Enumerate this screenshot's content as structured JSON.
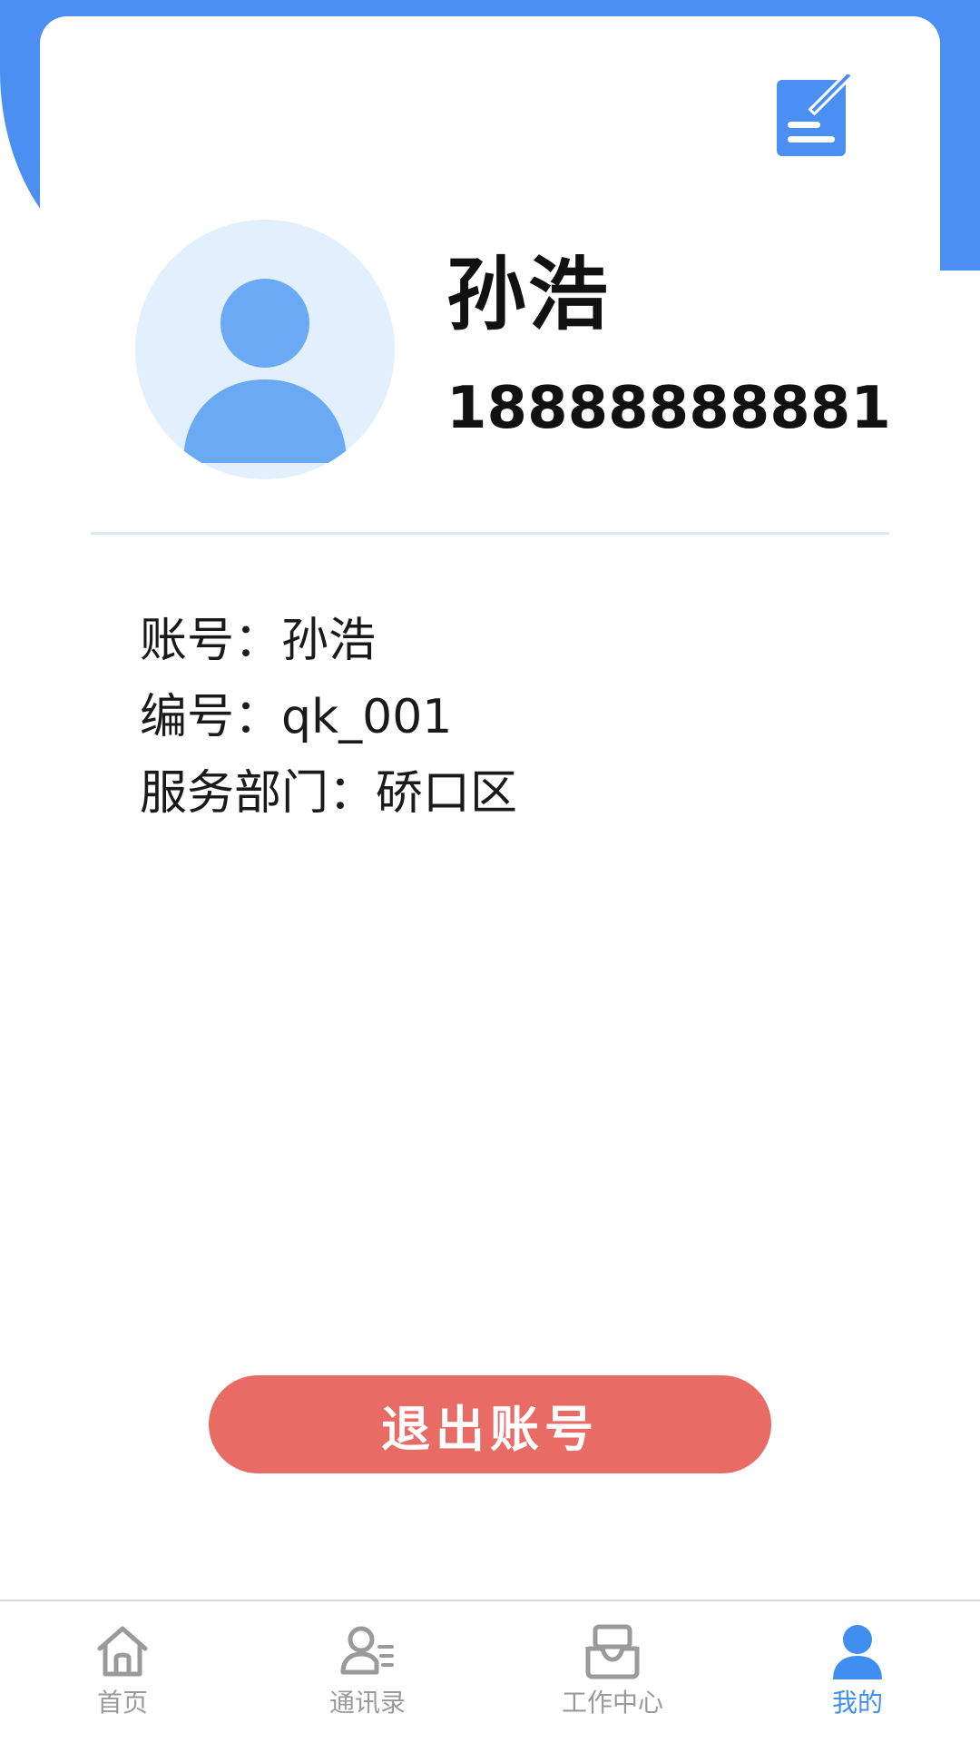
{
  "profile": {
    "name": "孙浩",
    "phone": "18888888881"
  },
  "info": {
    "account": "账号：孙浩",
    "number": "编号：qk_001",
    "department": "服务部门：硚口区"
  },
  "actions": {
    "logout_label": "退出账号"
  },
  "tab_bar": {
    "items": [
      {
        "label": "首页",
        "icon": "home-icon",
        "active": false
      },
      {
        "label": "通讯录",
        "icon": "contacts-icon",
        "active": false
      },
      {
        "label": "工作中心",
        "icon": "work-center-icon",
        "active": false
      },
      {
        "label": "我的",
        "icon": "user-icon",
        "active": true
      }
    ]
  },
  "colors": {
    "primary": "#4a8ff1",
    "avatar_bg": "#e2effd",
    "avatar_fg": "#6aaaf5",
    "logout": "#e86b66",
    "tab_inactive": "#9a9a9a",
    "tab_active": "#3f8ef0"
  }
}
